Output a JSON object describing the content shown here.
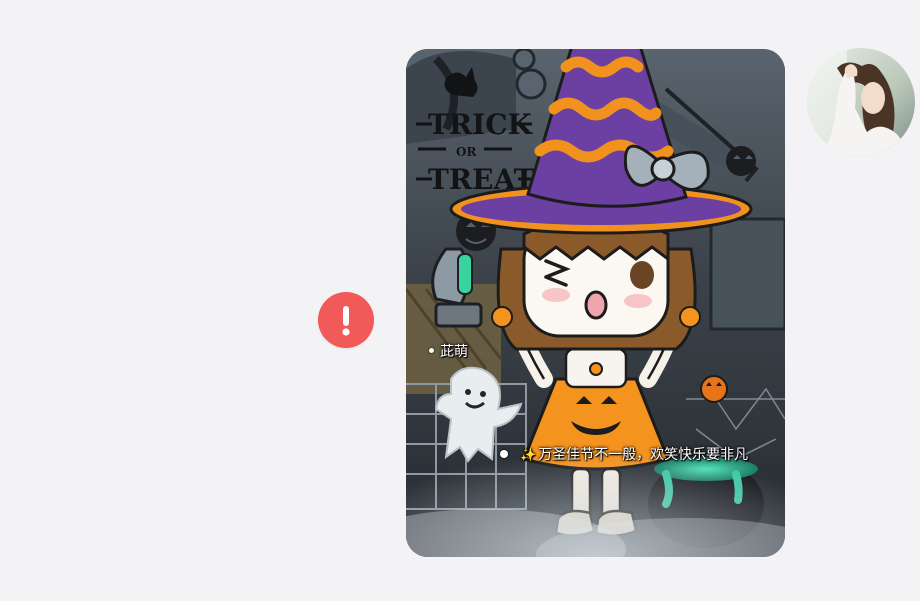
{
  "message": {
    "status": "send-failed",
    "status_icon": "exclamation-icon",
    "image_lettering": [
      "TRICK",
      "OR",
      "TREAT"
    ],
    "captions": {
      "line1": "茈萌",
      "line2": "万圣佳节不一般，欢笑快乐要非凡"
    },
    "sparkle": "✨"
  },
  "colors": {
    "page_background": "#f3f3f5",
    "error_red": "#f25a5a",
    "hat_purple": "#6c3fa2",
    "hat_orange": "#f2921e",
    "pumpkin_orange": "#f5931f",
    "slime_green": "#3fc9a4"
  }
}
